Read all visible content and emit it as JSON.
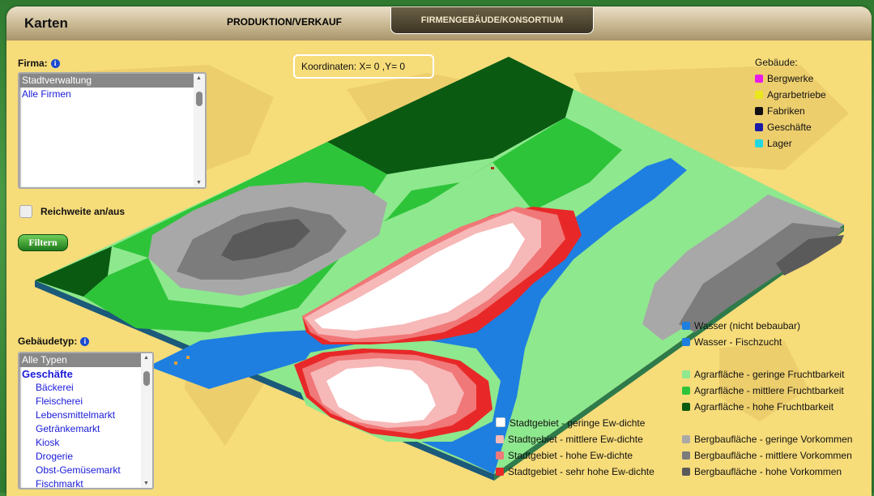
{
  "header": {
    "title": "Karten",
    "tabs": [
      {
        "label": "PRODUKTION/VERKAUF",
        "active": false
      },
      {
        "label": "FIRMENGEBÄUDE/KONSORTIUM",
        "active": true
      }
    ]
  },
  "firma": {
    "label": "Firma:",
    "info_icon": "info-icon",
    "items": [
      "Stadtverwaltung",
      "Alle Firmen"
    ],
    "selected": "Stadtverwaltung"
  },
  "reichweite": {
    "label": "Reichweite an/aus",
    "checked": false
  },
  "filter_button": "Filtern",
  "coordinates": "Koordinaten: X= 0 ,Y= 0",
  "gebaeudetyp": {
    "label": "Gebäudetyp:",
    "items": [
      "Alle Typen",
      "Geschäfte",
      "Bäckerei",
      "Fleischerei",
      "Lebensmittelmarkt",
      "Getränkemarkt",
      "Kiosk",
      "Drogerie",
      "Obst-Gemüsemarkt",
      "Fischmarkt"
    ]
  },
  "buildings_legend": {
    "title": "Gebäude:",
    "items": [
      {
        "label": "Bergwerke",
        "color": "#e81ce8"
      },
      {
        "label": "Agrarbetriebe",
        "color": "#e8e81c"
      },
      {
        "label": "Fabriken",
        "color": "#111111"
      },
      {
        "label": "Geschäfte",
        "color": "#1a1aa8"
      },
      {
        "label": "Lager",
        "color": "#22d8e0"
      }
    ]
  },
  "terrain_legend": [
    {
      "label": "Wasser (nicht bebaubar)",
      "color": "#1e7fe0"
    },
    {
      "label": "Wasser - Fischzucht",
      "color": "#1e7fe0"
    },
    {
      "label": "Agrarfläche - geringe Fruchtbarkeit",
      "color": "#8ee88e"
    },
    {
      "label": "Agrarfläche - mittlere Fruchtbarkeit",
      "color": "#2ec43a"
    },
    {
      "label": "Agrarfläche - hohe Fruchtbarkeit",
      "color": "#0a5a12"
    }
  ],
  "city_legend": [
    {
      "label": "Stadtgebiet - geringe Ew-dichte",
      "color": "#ffffff"
    },
    {
      "label": "Stadtgebiet - mittlere Ew-dichte",
      "color": "#f7b8b8"
    },
    {
      "label": "Stadtgebiet - hohe Ew-dichte",
      "color": "#f07878"
    },
    {
      "label": "Stadtgebiet - sehr hohe Ew-dichte",
      "color": "#e82828"
    }
  ],
  "mountain_legend": [
    {
      "label": "Bergbaufläche - geringe Vorkommen",
      "color": "#a8a8a8"
    },
    {
      "label": "Bergbaufläche - mittlere Vorkommen",
      "color": "#7c7c7c"
    },
    {
      "label": "Bergbaufläche - hohe Vorkommen",
      "color": "#5a5a5a"
    }
  ]
}
